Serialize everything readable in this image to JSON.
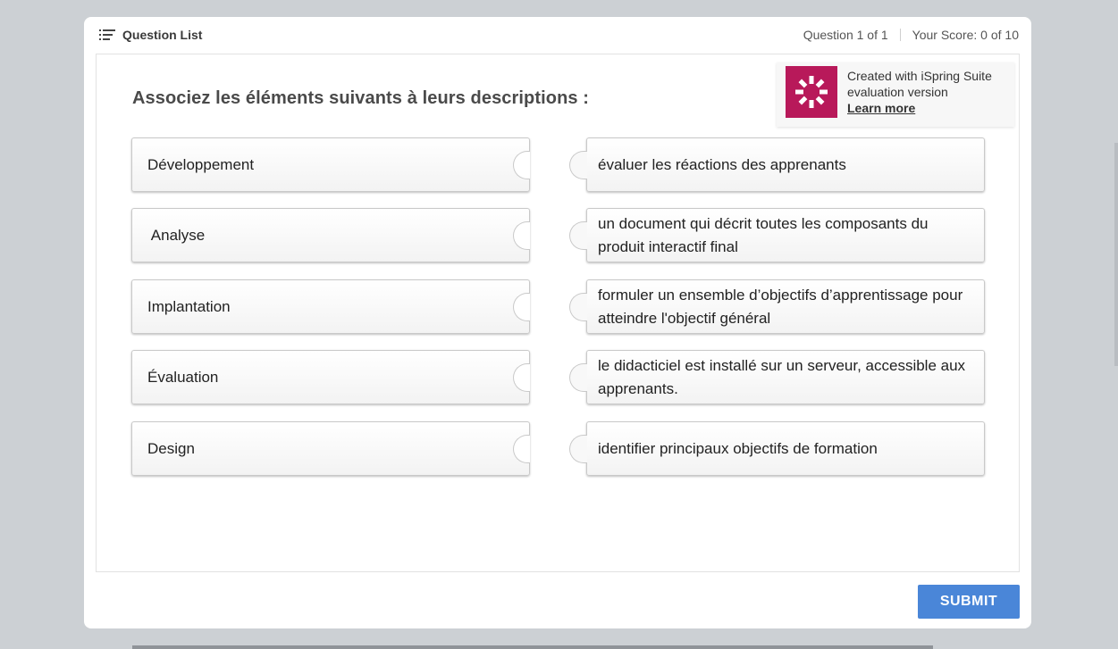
{
  "header": {
    "question_list_label": "Question List",
    "question_counter": "Question 1 of 1",
    "score": "Your Score: 0 of 10"
  },
  "question": {
    "text": "Associez les éléments suivants à leurs descriptions :"
  },
  "watermark": {
    "line1": "Created with iSpring Suite",
    "line2": "evaluation version",
    "link": "Learn more",
    "logo_color": "#b8195a"
  },
  "items": [
    {
      "term": "Développement",
      "description": "évaluer les réactions des apprenants"
    },
    {
      "term": " Analyse",
      "description": "un document qui décrit toutes les composants du produit interactif final"
    },
    {
      "term": "Implantation",
      "description": "formuler un ensemble d’objectifs d’apprentissage pour atteindre l'objectif général"
    },
    {
      "term": "Évaluation",
      "description": "le didacticiel est installé sur un serveur, accessible aux apprenants."
    },
    {
      "term": "Design",
      "description": "identifier principaux objectifs de formation"
    }
  ],
  "footer": {
    "submit_label": "SUBMIT",
    "submit_color": "#4a86d8"
  },
  "icons": {
    "question_list": "list-icon",
    "logo": "ispring-logo-icon",
    "puzzle_notch": "puzzle-notch-icon",
    "puzzle_tab": "puzzle-tab-icon"
  }
}
